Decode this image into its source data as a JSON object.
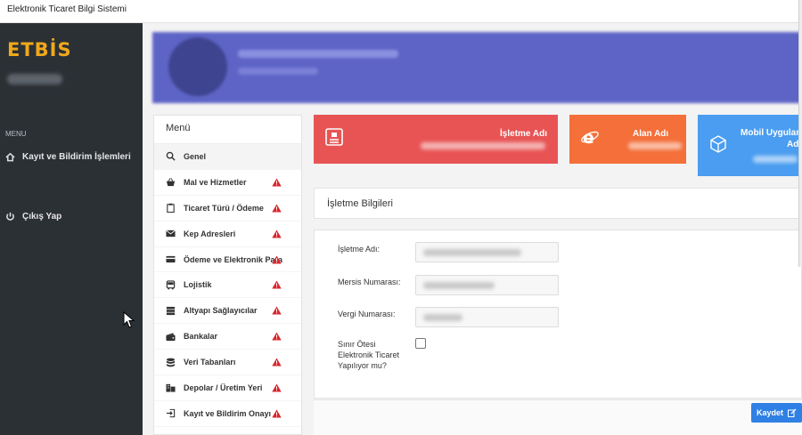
{
  "window": {
    "title": "Elektronik Ticaret Bilgi Sistemi"
  },
  "sidebar": {
    "logo": "ETBİS",
    "menu_heading": "MENU",
    "items": [
      {
        "label": "Kayıt ve Bildirim İşlemleri",
        "icon": "home-icon"
      },
      {
        "label": "Çıkış Yap",
        "icon": "power-icon"
      }
    ]
  },
  "menu": {
    "title": "Menü",
    "items": [
      {
        "label": "Genel",
        "icon": "search-icon",
        "warning": false
      },
      {
        "label": "Mal ve Hizmetler",
        "icon": "basket-icon",
        "warning": true
      },
      {
        "label": "Ticaret Türü / Ödeme",
        "icon": "clipboard-icon",
        "warning": true
      },
      {
        "label": "Kep Adresleri",
        "icon": "envelope-icon",
        "warning": true
      },
      {
        "label": "Ödeme ve Elektronik Para",
        "icon": "credit-card-icon",
        "warning": true
      },
      {
        "label": "Lojistik",
        "icon": "bus-icon",
        "warning": true
      },
      {
        "label": "Altyapı Sağlayıcılar",
        "icon": "server-icon",
        "warning": true
      },
      {
        "label": "Bankalar",
        "icon": "wallet-icon",
        "warning": true
      },
      {
        "label": "Veri Tabanları",
        "icon": "database-icon",
        "warning": true
      },
      {
        "label": "Depolar / Üretim Yeri",
        "icon": "building-icon",
        "warning": true
      },
      {
        "label": "Kayıt ve Bildirim Onayı",
        "icon": "sign-in-icon",
        "warning": true
      }
    ]
  },
  "cards": [
    {
      "title": "İşletme Adı",
      "color": "#e85454",
      "icon": "id-card-icon"
    },
    {
      "title": "Alan Adı",
      "color": "#f46f3a",
      "icon": "ie-icon"
    },
    {
      "title_line1": "Mobil Uygulama",
      "title_line2": "Adı",
      "color": "#4a9df0",
      "icon": "cube-icon"
    }
  ],
  "business_info": {
    "header": "İşletme Bilgileri",
    "fields": [
      {
        "label": "İşletme Adı:"
      },
      {
        "label": "Mersis Numarası:"
      },
      {
        "label": "Vergi Numarası:"
      }
    ],
    "cross_border": {
      "label_lines": [
        "Sınır Ötesi",
        "Elektronik Ticaret",
        "Yapılıyor mu?"
      ],
      "checked": false
    }
  },
  "actions": {
    "save_label": "Kaydet"
  },
  "colors": {
    "accent": "#2f80e4",
    "sidebar_bg": "#2b3035",
    "logo": "#f0a81b",
    "warning": "#d9262c"
  }
}
